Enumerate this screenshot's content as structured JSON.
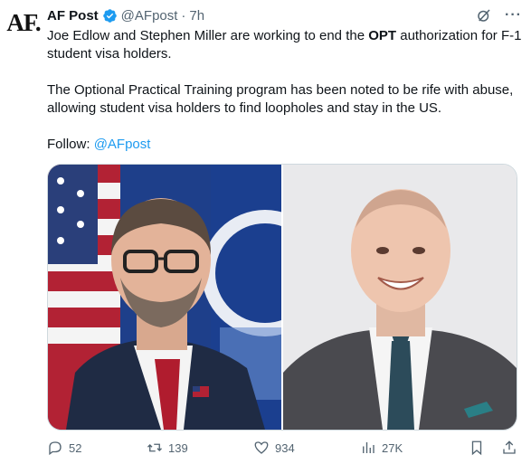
{
  "account": {
    "avatar_text": "AF.",
    "name": "AF Post",
    "handle": "@AFpost",
    "dot": "·",
    "time": "7h"
  },
  "tweet": {
    "line1_before": "Joe Edlow and Stephen Miller are working to end the ",
    "line1_bold": "OPT",
    "line1_after": " authorization for F-1 student visa holders.",
    "paragraph2": "The Optional Practical Training program has been noted to be rife with abuse, allowing student visa holders to find loopholes and stay in the US.",
    "follow_label": "Follow: ",
    "follow_link": "@AFpost"
  },
  "media": {
    "photos": [
      {
        "subject": "Joe Edlow"
      },
      {
        "subject": "Stephen Miller"
      }
    ]
  },
  "stats": {
    "replies": "52",
    "reposts": "139",
    "likes": "934",
    "views": "27K"
  },
  "icons": {
    "verified": "verified-badge-icon",
    "grok": "grok-icon",
    "more": "more-icon",
    "reply": "reply-icon",
    "repost": "repost-icon",
    "like": "heart-icon",
    "views": "views-icon",
    "bookmark": "bookmark-icon",
    "share": "share-icon"
  },
  "colors": {
    "accent": "#1d9bf0",
    "muted": "#536471",
    "text": "#0f1419"
  }
}
